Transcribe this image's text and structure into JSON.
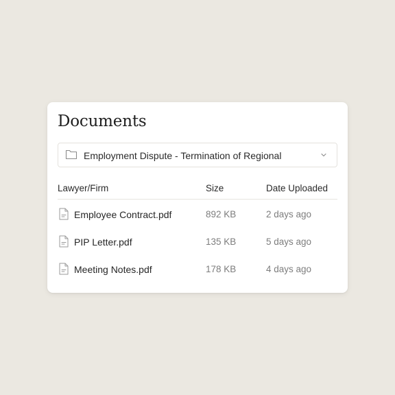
{
  "documents": {
    "title": "Documents",
    "case_select": {
      "value": "Employment Dispute - Termination of Regional",
      "icon": "folder-icon"
    },
    "table": {
      "headers": [
        "Lawyer/Firm",
        "Size",
        "Date Uploaded"
      ],
      "rows": [
        {
          "name": "Employee Contract.pdf",
          "size": "892 KB",
          "date": "2 days ago",
          "icon": "file-icon"
        },
        {
          "name": "PIP Letter.pdf",
          "size": "135 KB",
          "date": "5 days ago",
          "icon": "file-icon"
        },
        {
          "name": "Meeting Notes.pdf",
          "size": "178 KB",
          "date": "4 days ago",
          "icon": "file-icon"
        }
      ]
    }
  },
  "colors": {
    "background": "#ebe8e1",
    "card": "#ffffff",
    "text_primary": "#262626",
    "text_muted": "#7d7d7d",
    "border": "#e4e2dd"
  }
}
